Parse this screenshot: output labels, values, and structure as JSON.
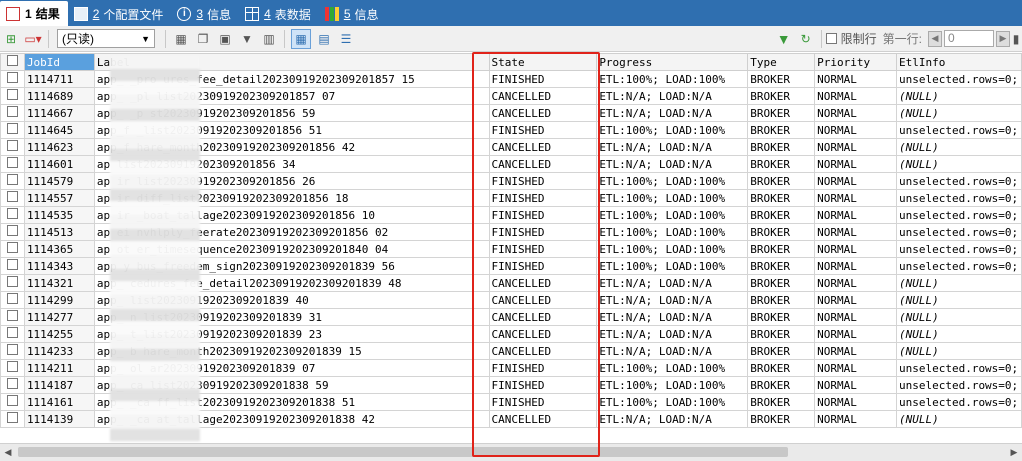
{
  "tabs": [
    {
      "num": "1",
      "label": "结果",
      "icon": "result-grid-icon",
      "active": true
    },
    {
      "num": "2",
      "label": "个配置文件",
      "icon": "config-file-icon",
      "active": false
    },
    {
      "num": "3",
      "label": "信息",
      "icon": "info-icon",
      "active": false
    },
    {
      "num": "4",
      "label": "表数据",
      "icon": "table-data-icon",
      "active": false
    },
    {
      "num": "5",
      "label": "信息",
      "icon": "chart-info-icon",
      "active": false
    }
  ],
  "toolbar": {
    "mode_select": "(只读)",
    "limit_label": "限制行",
    "first_row_label": "第一行:",
    "first_row_value": "0"
  },
  "columns": [
    "JobId",
    "Label",
    "State",
    "Progress",
    "Type",
    "Priority",
    "EtlInfo"
  ],
  "rows": [
    {
      "jobid": "1114711",
      "label": "app_      _pro    ures_fee_detail20230919202309201857 15",
      "state": "FINISHED",
      "progress": "ETL:100%; LOAD:100%",
      "type": "BROKER",
      "priority": "NORMAL",
      "etl": "unselected.rows=0;",
      "null": false
    },
    {
      "jobid": "1114689",
      "label": "app_    _pl    list20230919202309201857 07",
      "state": "CANCELLED",
      "progress": "ETL:N/A; LOAD:N/A",
      "type": "BROKER",
      "priority": "NORMAL",
      "etl": "(NULL)",
      "null": true
    },
    {
      "jobid": "1114667",
      "label": "app_    _p     st20230919202309201856 59",
      "state": "CANCELLED",
      "progress": "ETL:N/A; LOAD:N/A",
      "type": "BROKER",
      "priority": "NORMAL",
      "etl": "(NULL)",
      "null": true
    },
    {
      "jobid": "1114645",
      "label": "app_f          _list20230919202309201856 51",
      "state": "FINISHED",
      "progress": "ETL:100%; LOAD:100%",
      "type": "BROKER",
      "priority": "NORMAL",
      "etl": "unselected.rows=0;",
      "null": false
    },
    {
      "jobid": "1114623",
      "label": "app_f        hare_month20230919202309201856 42",
      "state": "CANCELLED",
      "progress": "ETL:N/A; LOAD:N/A",
      "type": "BROKER",
      "priority": "NORMAL",
      "etl": "(NULL)",
      "null": true
    },
    {
      "jobid": "1114601",
      "label": "ap          list20230919202309201856 34",
      "state": "CANCELLED",
      "progress": "ETL:N/A; LOAD:N/A",
      "type": "BROKER",
      "priority": "NORMAL",
      "etl": "(NULL)",
      "null": true
    },
    {
      "jobid": "1114579",
      "label": "ap       ir    list20230919202309201856 26",
      "state": "FINISHED",
      "progress": "ETL:100%; LOAD:100%",
      "type": "BROKER",
      "priority": "NORMAL",
      "etl": "unselected.rows=0;",
      "null": false
    },
    {
      "jobid": "1114557",
      "label": "ap       ir    diff_list20230919202309201856 18",
      "state": "FINISHED",
      "progress": "ETL:100%; LOAD:100%",
      "type": "BROKER",
      "priority": "NORMAL",
      "etl": "unselected.rows=0;",
      "null": false
    },
    {
      "jobid": "1114535",
      "label": "ap       ir    _boat_tallage20230919202309201856 10",
      "state": "FINISHED",
      "progress": "ETL:100%; LOAD:100%",
      "type": "BROKER",
      "priority": "NORMAL",
      "etl": "unselected.rows=0;",
      "null": false
    },
    {
      "jobid": "1114513",
      "label": "ap       ei    nvhlply_feerate20230919202309201856 02",
      "state": "FINISHED",
      "progress": "ETL:100%; LOAD:100%",
      "type": "BROKER",
      "priority": "NORMAL",
      "etl": "unselected.rows=0;",
      "null": false
    },
    {
      "jobid": "1114365",
      "label": "ap       ot    er_timesequence20230919202309201840 04",
      "state": "FINISHED",
      "progress": "ETL:100%; LOAD:100%",
      "type": "BROKER",
      "priority": "NORMAL",
      "etl": "unselected.rows=0;",
      "null": false
    },
    {
      "jobid": "1114343",
      "label": "app     y     bus_freedem_sign20230919202309201839 56",
      "state": "FINISHED",
      "progress": "ETL:100%; LOAD:100%",
      "type": "BROKER",
      "priority": "NORMAL",
      "etl": "unselected.rows=0;",
      "null": false
    },
    {
      "jobid": "1114321",
      "label": "app_       cedures_fee_detail20230919202309201839 48",
      "state": "CANCELLED",
      "progress": "ETL:N/A; LOAD:N/A",
      "type": "BROKER",
      "priority": "NORMAL",
      "etl": "(NULL)",
      "null": true
    },
    {
      "jobid": "1114299",
      "label": "app_         list20230919202309201839 40",
      "state": "CANCELLED",
      "progress": "ETL:N/A; LOAD:N/A",
      "type": "BROKER",
      "priority": "NORMAL",
      "etl": "(NULL)",
      "null": true
    },
    {
      "jobid": "1114277",
      "label": "app_     n    list20230919202309201839 31",
      "state": "CANCELLED",
      "progress": "ETL:N/A; LOAD:N/A",
      "type": "BROKER",
      "priority": "NORMAL",
      "etl": "(NULL)",
      "null": true
    },
    {
      "jobid": "1114255",
      "label": "app_         t_list20230919202309201839 23",
      "state": "CANCELLED",
      "progress": "ETL:N/A; LOAD:N/A",
      "type": "BROKER",
      "priority": "NORMAL",
      "etl": "(NULL)",
      "null": true
    },
    {
      "jobid": "1114233",
      "label": "app_     b     hare_month20230919202309201839 15",
      "state": "CANCELLED",
      "progress": "ETL:N/A; LOAD:N/A",
      "type": "BROKER",
      "priority": "NORMAL",
      "etl": "(NULL)",
      "null": true
    },
    {
      "jobid": "1114211",
      "label": "app_     ol    ar20230919202309201839 07",
      "state": "FINISHED",
      "progress": "ETL:100%; LOAD:100%",
      "type": "BROKER",
      "priority": "NORMAL",
      "etl": "unselected.rows=0;",
      "null": false
    },
    {
      "jobid": "1114187",
      "label": "app_     ca    list20230919202309201838 59",
      "state": "FINISHED",
      "progress": "ETL:100%; LOAD:100%",
      "type": "BROKER",
      "priority": "NORMAL",
      "etl": "unselected.rows=0;",
      "null": false
    },
    {
      "jobid": "1114161",
      "label": "app_     _ca    ff_list20230919202309201838 51",
      "state": "FINISHED",
      "progress": "ETL:100%; LOAD:100%",
      "type": "BROKER",
      "priority": "NORMAL",
      "etl": "unselected.rows=0;",
      "null": false
    },
    {
      "jobid": "1114139",
      "label": "app_     _ca    at_tallage20230919202309201838 42",
      "state": "CANCELLED",
      "progress": "ETL:N/A; LOAD:N/A",
      "type": "BROKER",
      "priority": "NORMAL",
      "etl": "(NULL)",
      "null": true
    }
  ]
}
